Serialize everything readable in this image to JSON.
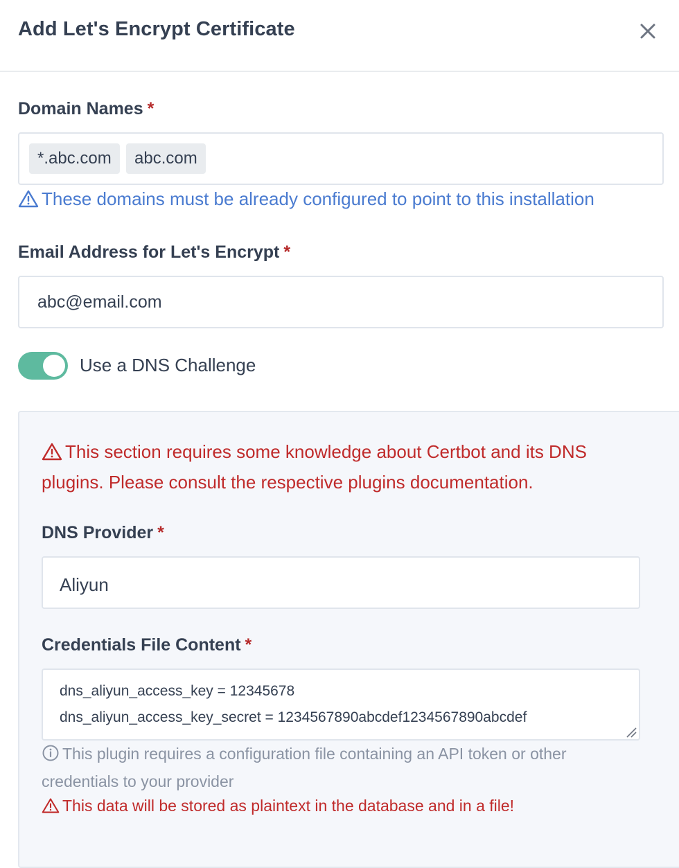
{
  "modal": {
    "title": "Add Let's Encrypt Certificate"
  },
  "domain_names": {
    "label": "Domain Names",
    "required_mark": "*",
    "tags": [
      "*.abc.com",
      "abc.com"
    ],
    "hint": "These domains must be already configured to point to this installation"
  },
  "email": {
    "label": "Email Address for Let's Encrypt",
    "required_mark": "*",
    "value": "abc@email.com"
  },
  "dns_challenge": {
    "label": "Use a DNS Challenge",
    "enabled": true
  },
  "dns_section": {
    "warning": "This section requires some knowledge about Certbot and its DNS plugins. Please consult the respective plugins documentation.",
    "provider_label": "DNS Provider",
    "provider_required_mark": "*",
    "provider_value": "Aliyun",
    "credentials_label": "Credentials File Content",
    "credentials_required_mark": "*",
    "credentials_lines": [
      "dns_aliyun_access_key = 12345678",
      "dns_aliyun_access_key_secret = 1234567890abcdef1234567890abcdef"
    ],
    "credentials_info": "This plugin requires a configuration file containing an API token or other credentials to your provider",
    "plaintext_warning": "This data will be stored as plaintext in the database and in a file!"
  },
  "colors": {
    "accent_toggle": "#5eba9f",
    "danger": "#c02b2b",
    "hint_blue": "#4a7bd0"
  }
}
